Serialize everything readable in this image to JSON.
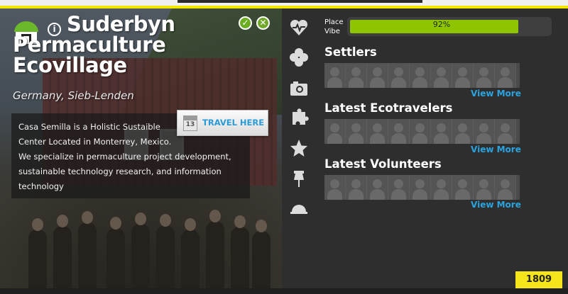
{
  "place": {
    "title": "Suderbyn Permaculture Ecovillage",
    "location": "Germany, Sieb-Lenden",
    "description_lines": [
      "Casa Semilla is a Holistic Sustaible",
      "Center Located in Monterrey, Mexico.",
      "We specialize in permaculture project development,",
      "sustainable technology research, and information",
      "technology"
    ],
    "travel_button": {
      "label": "TRAVEL HERE",
      "calendar_day": "13"
    }
  },
  "vibe": {
    "label_line1": "Place",
    "label_line2": "Vibe",
    "percent": 92,
    "percent_text": "92%"
  },
  "sections": [
    {
      "title": "Settlers",
      "view_more": "View More",
      "avatar_count": 9
    },
    {
      "title": "Latest Ecotravelers",
      "view_more": "View More",
      "avatar_count": 9
    },
    {
      "title": "Latest Volunteers",
      "view_more": "View More",
      "avatar_count": 9
    }
  ],
  "sidebar_icons": [
    "heart-pulse-icon",
    "clover-icon",
    "camera-icon",
    "puzzle-icon",
    "star-icon",
    "pin-icon",
    "cap-icon"
  ],
  "counter": "1809",
  "colors": {
    "accent_yellow": "#f2e600",
    "vibe_green": "#8fc400",
    "link_blue": "#2aa4e0"
  }
}
